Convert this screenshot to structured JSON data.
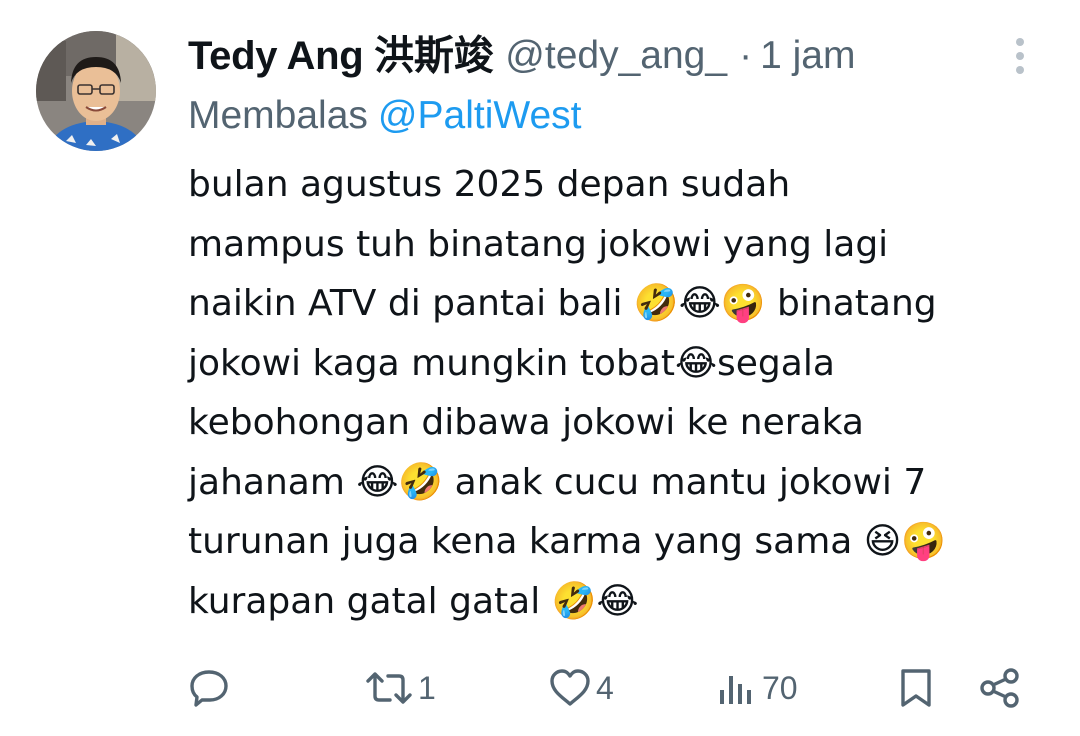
{
  "user": {
    "display_name": "Tedy Ang 洪斯竣",
    "handle": "@tedy_ang_",
    "separator": "·",
    "time": "1 jam"
  },
  "reply": {
    "prefix": "Membalas",
    "mention": "@PaltiWest"
  },
  "tweet": {
    "lines": [
      "bulan agustus 2025 depan sudah",
      "mampus tuh binatang jokowi yang lagi",
      "naikin ATV di pantai bali 🤣😂🤪 binatang",
      "jokowi kaga mungkin tobat😂segala",
      "kebohongan dibawa jokowi ke neraka",
      "jahanam 😂🤣 anak cucu mantu jokowi 7",
      "turunan juga kena karma yang sama 😆🤪",
      "kurapan gatal gatal 🤣😂"
    ]
  },
  "actions": {
    "reply_count": "",
    "retweet_count": "1",
    "like_count": "4",
    "view_count": "70"
  },
  "icons": {
    "reply": "reply-bubble-icon",
    "retweet": "retweet-icon",
    "like": "heart-icon",
    "views": "views-chart-icon",
    "bookmark": "bookmark-icon",
    "share": "share-icon",
    "more": "more-vertical-icon"
  },
  "colors": {
    "text": "#0f1419",
    "secondary": "#536471",
    "accent": "#1d9bf0"
  }
}
